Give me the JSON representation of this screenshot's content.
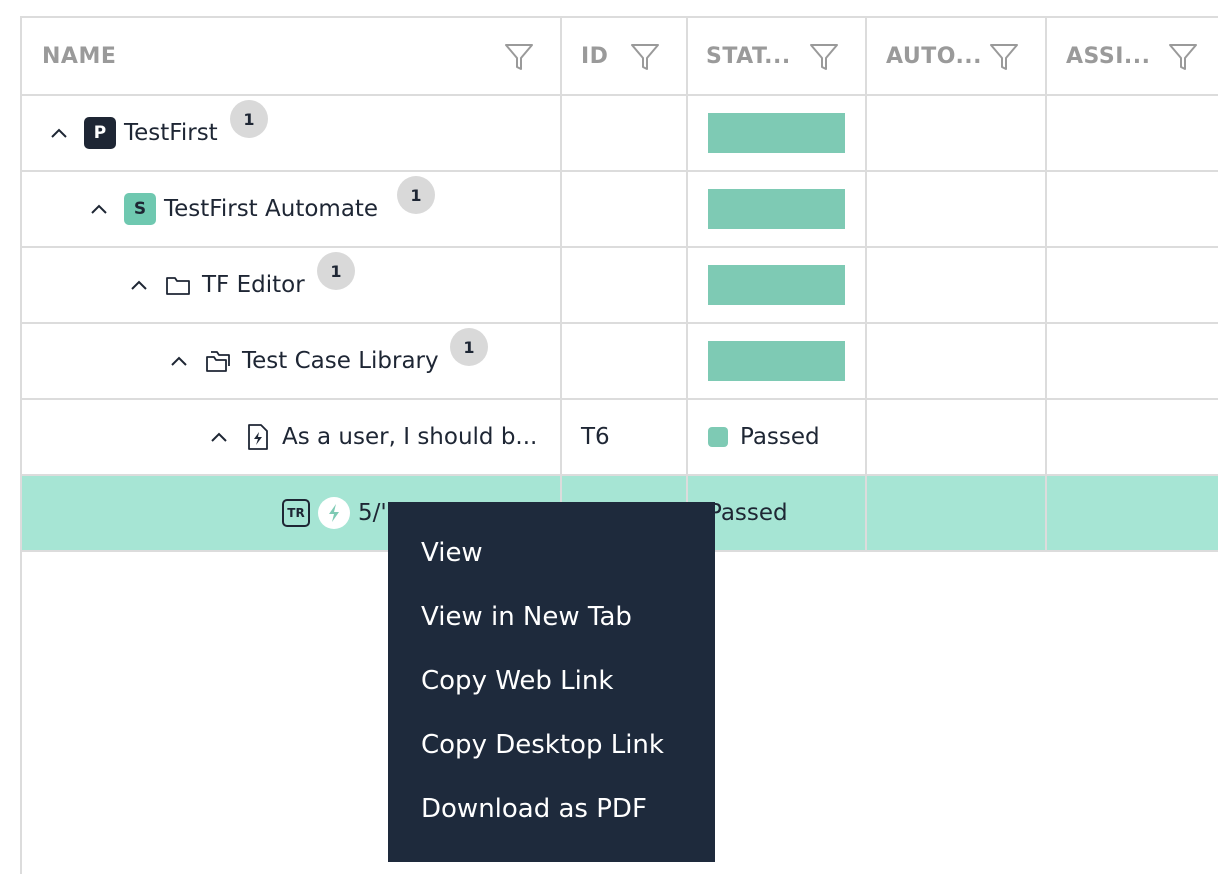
{
  "columns": [
    {
      "label": "NAME"
    },
    {
      "label": "ID"
    },
    {
      "label": "STAT..."
    },
    {
      "label": "AUTO..."
    },
    {
      "label": "ASSI..."
    }
  ],
  "rows": [
    {
      "badge": "P",
      "name": "TestFirst",
      "count": "1",
      "id": "",
      "status": ""
    },
    {
      "badge": "S",
      "name": "TestFirst Automate",
      "count": "1",
      "id": "",
      "status": ""
    },
    {
      "name": "TF Editor",
      "count": "1",
      "id": "",
      "status": ""
    },
    {
      "name": "Test Case Library",
      "count": "1",
      "id": "",
      "status": ""
    },
    {
      "name": "As a user, I should b...",
      "id": "T6",
      "status": "Passed"
    },
    {
      "badge": "TR",
      "name": "5/'",
      "status": "Passed"
    }
  ],
  "context_menu": {
    "items": [
      "View",
      "View in New Tab",
      "Copy Web Link",
      "Copy Desktop Link",
      "Download as PDF"
    ]
  },
  "colors": {
    "status_passed": "#7ecab4",
    "selected_row": "#a6e5d4",
    "menu_bg": "#1e2a3c",
    "dark": "#1e2634"
  }
}
